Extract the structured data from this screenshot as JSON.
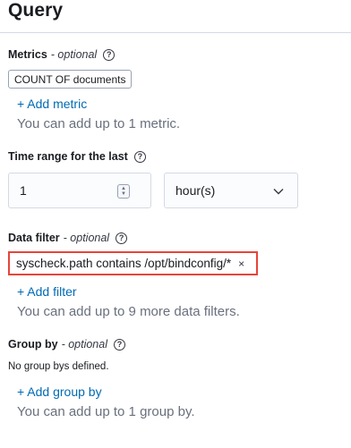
{
  "title": "Query",
  "metrics": {
    "label": "Metrics",
    "optional": "- optional",
    "chip": "COUNT OF documents",
    "add_label": "+ Add metric",
    "hint": "You can add up to 1 metric."
  },
  "time_range": {
    "label": "Time range for the last",
    "value": "1",
    "unit": "hour(s)"
  },
  "data_filter": {
    "label": "Data filter",
    "optional": "- optional",
    "filter_text": "syscheck.path contains /opt/bindconfig/*",
    "remove": "×",
    "add_label": "+ Add filter",
    "hint": "You can add up to 9 more data filters."
  },
  "group_by": {
    "label": "Group by",
    "optional": "- optional",
    "empty": "No group bys defined.",
    "add_label": "+ Add group by",
    "hint": "You can add up to 1 group by."
  },
  "icons": {
    "help": "question-circle-icon",
    "chevron": "chevron-down-icon",
    "close": "close-icon"
  },
  "colors": {
    "link": "#006bb4",
    "highlight": "#e7453a",
    "hint": "#69707d"
  }
}
